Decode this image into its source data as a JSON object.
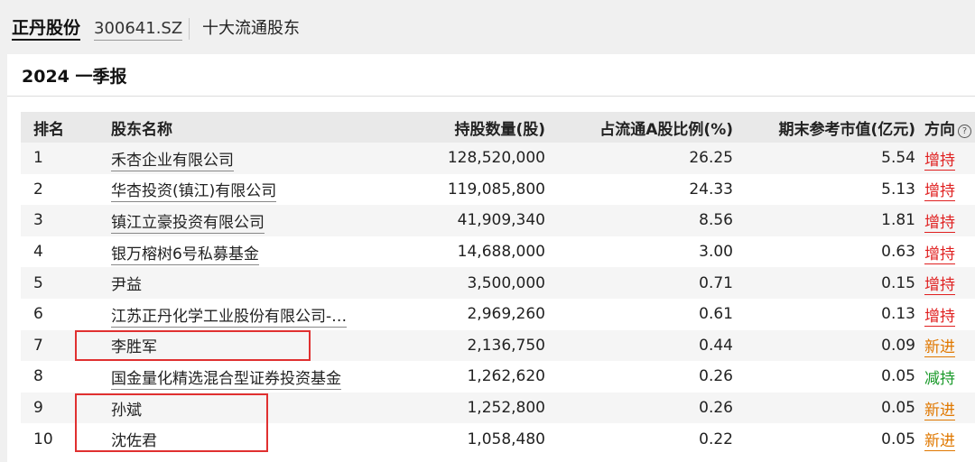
{
  "header": {
    "stock_name": "正丹股份",
    "stock_code": "300641.SZ",
    "section": "十大流通股东"
  },
  "report_period": "2024 一季报",
  "table": {
    "columns": [
      "排名",
      "股东名称",
      "持股数量(股)",
      "占流通A股比例(%)",
      "期末参考市值(亿元)",
      "方向"
    ],
    "help_icon": "question-circle-icon",
    "rows": [
      {
        "rank": "1",
        "name": "禾杏企业有限公司",
        "shares": "128,520,000",
        "pct": "26.25",
        "value": "5.54",
        "direction": "增持",
        "dir_type": "inc",
        "name_link": true
      },
      {
        "rank": "2",
        "name": "华杏投资(镇江)有限公司",
        "shares": "119,085,800",
        "pct": "24.33",
        "value": "5.13",
        "direction": "增持",
        "dir_type": "inc",
        "name_link": true
      },
      {
        "rank": "3",
        "name": "镇江立豪投资有限公司",
        "shares": "41,909,340",
        "pct": "8.56",
        "value": "1.81",
        "direction": "增持",
        "dir_type": "inc",
        "name_link": true
      },
      {
        "rank": "4",
        "name": "银万榕树6号私募基金",
        "shares": "14,688,000",
        "pct": "3.00",
        "value": "0.63",
        "direction": "增持",
        "dir_type": "inc",
        "name_link": true
      },
      {
        "rank": "5",
        "name": "尹益",
        "shares": "3,500,000",
        "pct": "0.71",
        "value": "0.15",
        "direction": "增持",
        "dir_type": "inc",
        "name_link": false
      },
      {
        "rank": "6",
        "name": "江苏正丹化学工业股份有限公司-…",
        "shares": "2,969,260",
        "pct": "0.61",
        "value": "0.13",
        "direction": "增持",
        "dir_type": "inc",
        "name_link": true
      },
      {
        "rank": "7",
        "name": "李胜军",
        "shares": "2,136,750",
        "pct": "0.44",
        "value": "0.09",
        "direction": "新进",
        "dir_type": "new",
        "name_link": false
      },
      {
        "rank": "8",
        "name": "国金量化精选混合型证券投资基金",
        "shares": "1,262,620",
        "pct": "0.26",
        "value": "0.05",
        "direction": "减持",
        "dir_type": "dec",
        "name_link": true
      },
      {
        "rank": "9",
        "name": "孙斌",
        "shares": "1,252,800",
        "pct": "0.26",
        "value": "0.05",
        "direction": "新进",
        "dir_type": "new",
        "name_link": false
      },
      {
        "rank": "10",
        "name": "沈佐君",
        "shares": "1,058,480",
        "pct": "0.22",
        "value": "0.05",
        "direction": "新进",
        "dir_type": "new",
        "name_link": false
      }
    ]
  },
  "colors": {
    "increase": "#e02020",
    "new": "#e07800",
    "decrease": "#1a9a2a",
    "highlight_box": "#e03030"
  }
}
